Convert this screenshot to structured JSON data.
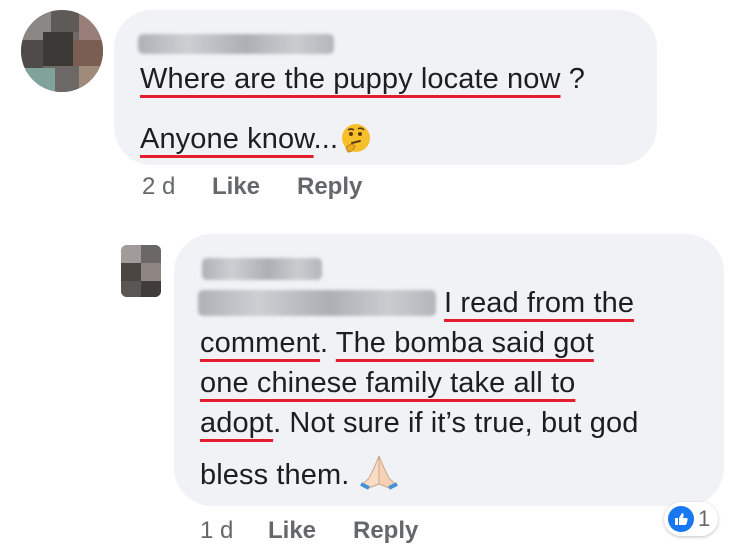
{
  "comment": {
    "author_redacted": true,
    "line1_before": "",
    "line1_misspelled": "Where are the puppy locate now",
    "line1_after": " ?",
    "line2_misspelled": "Anyone know",
    "line2_after": "...",
    "emoji": "thinking-face",
    "timestamp": "2 d",
    "like_label": "Like",
    "reply_label": "Reply"
  },
  "reply": {
    "author_redacted": true,
    "tag_redacted": true,
    "line1_misspelled": "I read from the",
    "line2_misspelled_a": "comment",
    "line2_mid": ". ",
    "line2_misspelled_b": "The bomba said got",
    "line3_misspelled": "one chinese family take all to",
    "line4_misspelled": "adopt",
    "line4_after": ". Not sure if it’s true, but god",
    "line5": "bless them.",
    "emoji": "folded-hands",
    "timestamp": "1 d",
    "like_label": "Like",
    "reply_label": "Reply",
    "reaction_count": "1"
  },
  "colors": {
    "bubble": "#f0f2f5",
    "text": "#1c1e21",
    "meta": "#65676b",
    "spellcheck": "#e41e2c",
    "like_blue": "#1877f2"
  }
}
